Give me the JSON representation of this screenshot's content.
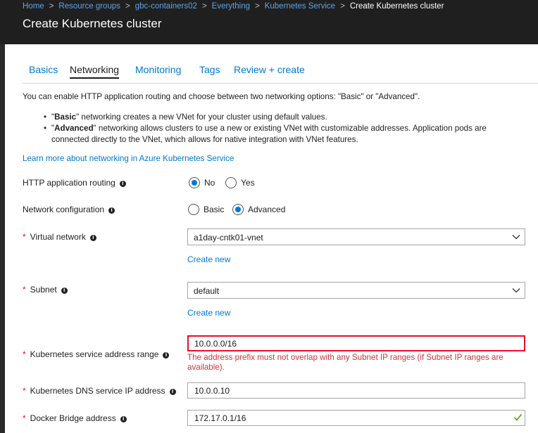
{
  "breadcrumb": {
    "items": [
      "Home",
      "Resource groups",
      "gbc-containers02",
      "Everything",
      "Kubernetes Service"
    ],
    "current": "Create Kubernetes cluster",
    "separator": ">"
  },
  "page": {
    "title": "Create Kubernetes cluster"
  },
  "tabs": [
    {
      "label": "Basics",
      "active": false
    },
    {
      "label": "Networking",
      "active": true
    },
    {
      "label": "Monitoring",
      "active": false
    },
    {
      "label": "Tags",
      "active": false
    },
    {
      "label": "Review + create",
      "active": false
    }
  ],
  "intro": {
    "text": "You can enable HTTP application routing and choose between two networking options: \"Basic\" or \"Advanced\".",
    "bullets": [
      {
        "bold": "Basic",
        "open_quote": "\"",
        "close_quote": "\"",
        "text": " networking creates a new VNet for your cluster using default values."
      },
      {
        "bold": "Advanced",
        "open_quote": "\"",
        "close_quote": "\"",
        "text": " networking allows clusters to use a new or existing VNet with customizable addresses. Application pods are connected directly to the VNet, which allows for native integration with VNet features."
      }
    ],
    "bullet_char": "•",
    "learn_more": "Learn more about networking in Azure Kubernetes Service"
  },
  "form": {
    "http_routing": {
      "label": "HTTP application routing",
      "options": [
        "No",
        "Yes"
      ],
      "selected": "No"
    },
    "network_config": {
      "label": "Network configuration",
      "options": [
        "Basic",
        "Advanced"
      ],
      "selected": "Advanced"
    },
    "virtual_network": {
      "label": "Virtual network",
      "value": "a1day-cntk01-vnet",
      "create_new": "Create new"
    },
    "subnet": {
      "label": "Subnet",
      "value": "default",
      "create_new": "Create new"
    },
    "service_address_range": {
      "label": "Kubernetes service address range",
      "value": "10.0.0.0/16",
      "error": "The address prefix must not overlap with any Subnet IP ranges (if Subnet IP ranges are available)."
    },
    "dns_service_ip": {
      "label": "Kubernetes DNS service IP address",
      "value": "10.0.0.10"
    },
    "docker_bridge": {
      "label": "Docker Bridge address",
      "value": "172.17.0.1/16"
    }
  },
  "required_marker": "*",
  "info_glyph": "i",
  "colors": {
    "accent": "#0078d4",
    "error": "#e81123",
    "valid": "#57a300",
    "topbar": "#1f1f1f"
  }
}
